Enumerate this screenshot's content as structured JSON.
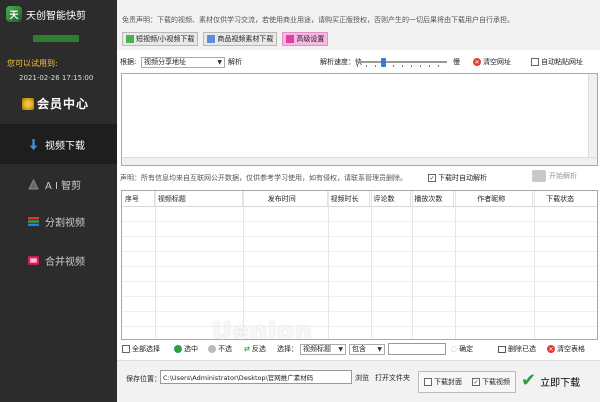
{
  "app": {
    "title": "天创智能快剪",
    "logo_glyph": "天"
  },
  "sidebar": {
    "trial_label": "您可以试用到:",
    "trial_date": "2021-02-26 17:15:00",
    "member_center": "会员中心",
    "nav": [
      {
        "label": "视频下载",
        "icon": "download-arrow-icon",
        "active": true
      },
      {
        "label": "A I 智剪",
        "icon": "ai-edit-icon",
        "active": false
      },
      {
        "label": "分割视频",
        "icon": "split-video-icon",
        "active": false
      },
      {
        "label": "合并视频",
        "icon": "merge-video-icon",
        "active": false
      }
    ]
  },
  "top": {
    "disclaimer": "免责声明：下载的视频、素材仅供学习交流，若使用商业用途，请购买正版授权，否则产生的一切后果将由下载用户自行承担。",
    "buttons": [
      {
        "label": "短视频/小视频下载",
        "icon": "video-icon"
      },
      {
        "label": "商品视频素材下载",
        "icon": "goods-icon"
      },
      {
        "label": "高级设置",
        "icon": "settings-icon"
      }
    ]
  },
  "parse": {
    "by_label": "根据:",
    "by_select": "视频分享地址",
    "parse_btn": "解析",
    "speed_label": "解析速度：快",
    "speed_slow": "慢",
    "clear_url": "清空网址",
    "auto_paste": "自动粘贴网址"
  },
  "note": {
    "text": "声明：所有信息均来自互联网公开数据，仅供参考学习使用，如有侵权，请联系管理员删除。",
    "auto_parse_download": "下载时自动解析",
    "start_parse": "开始解析"
  },
  "table": {
    "columns": [
      "序号",
      "视频标题",
      "发布时间",
      "视频时长",
      "评论数",
      "播放次数",
      "作者昵称",
      "下载状态"
    ],
    "rows": []
  },
  "actions": {
    "select_all": "全部选择",
    "select": "选中",
    "deselect": "不选",
    "invert": "反选",
    "choose_label": "选择：",
    "field_select": "视频标题",
    "match_select": "包含",
    "confirm": "确定",
    "delete_selected": "删除已选",
    "clear_table": "清空表格"
  },
  "bottom": {
    "save_label": "保存位置：",
    "save_path": "C:\\Users\\Administrator\\Desktop\\官网推广素材码",
    "browse": "浏览",
    "open_folder": "打开文件夹",
    "download_cover": "下载封面",
    "download_video": "下载视频",
    "download_now": "立即下载"
  },
  "watermark": "Uenion",
  "colors": {
    "sidebar_bg": "#2c2c2c",
    "accent_green": "#2e9e44",
    "accent_blue": "#3a7bd5",
    "danger": "#e53935",
    "trial": "#f6c23e"
  }
}
